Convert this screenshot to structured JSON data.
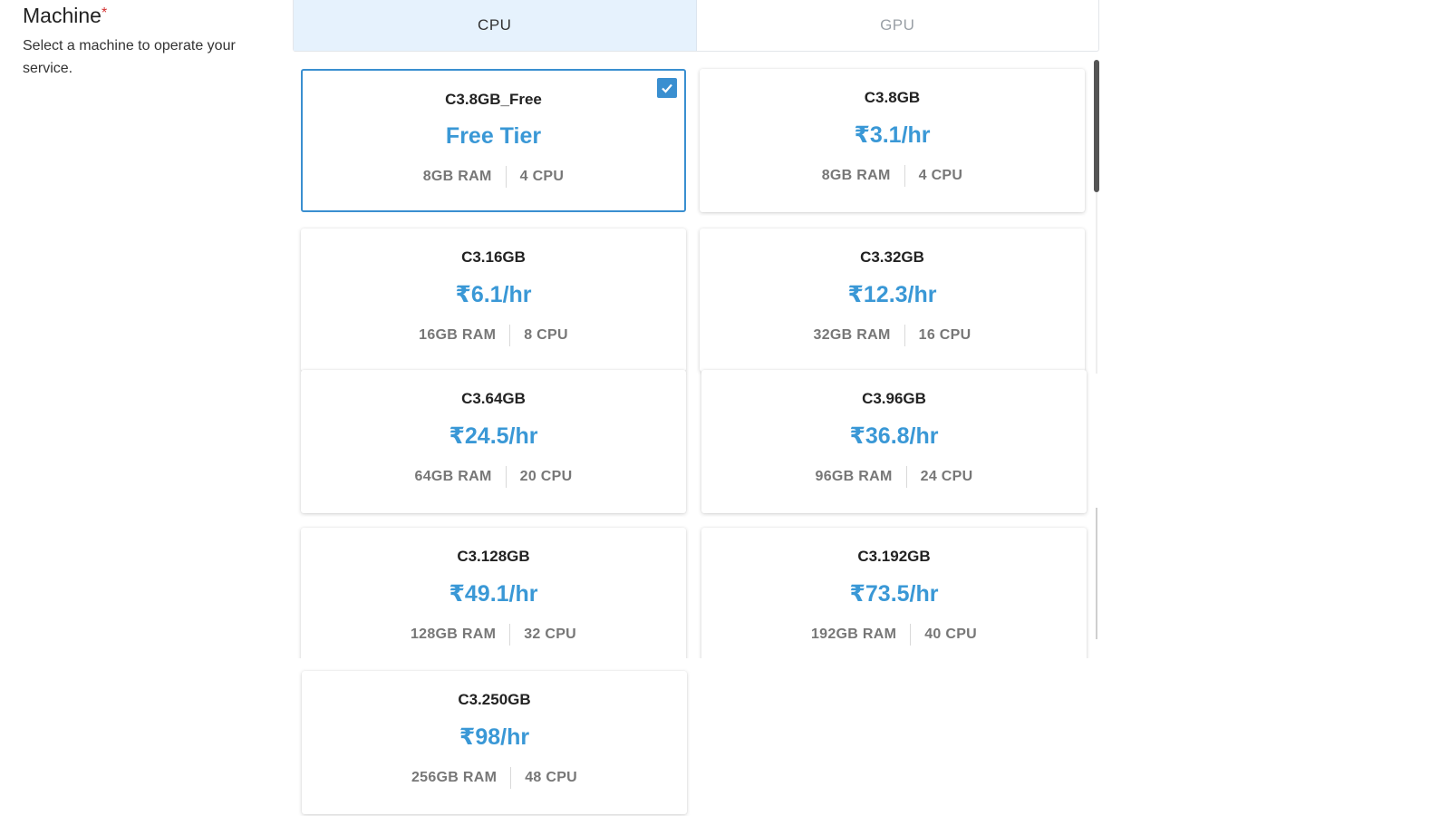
{
  "section": {
    "title": "Machine",
    "required_mark": "*",
    "description": "Select a machine to operate your service."
  },
  "tabs": [
    {
      "label": "CPU",
      "active": true
    },
    {
      "label": "GPU",
      "active": false
    }
  ],
  "machines": [
    {
      "name": "C3.8GB_Free",
      "price": "Free Tier",
      "ram": "8GB RAM",
      "cpu": "4 CPU",
      "selected": true
    },
    {
      "name": "C3.8GB",
      "price": "₹3.1/hr",
      "ram": "8GB RAM",
      "cpu": "4 CPU",
      "selected": false
    },
    {
      "name": "C3.16GB",
      "price": "₹6.1/hr",
      "ram": "16GB RAM",
      "cpu": "8 CPU",
      "selected": false
    },
    {
      "name": "C3.32GB",
      "price": "₹12.3/hr",
      "ram": "32GB RAM",
      "cpu": "16 CPU",
      "selected": false
    },
    {
      "name": "C3.64GB",
      "price": "₹24.5/hr",
      "ram": "64GB RAM",
      "cpu": "20 CPU",
      "selected": false
    },
    {
      "name": "C3.96GB",
      "price": "₹36.8/hr",
      "ram": "96GB RAM",
      "cpu": "24 CPU",
      "selected": false
    },
    {
      "name": "C3.128GB",
      "price": "₹49.1/hr",
      "ram": "128GB RAM",
      "cpu": "32 CPU",
      "selected": false
    },
    {
      "name": "C3.192GB",
      "price": "₹73.5/hr",
      "ram": "192GB RAM",
      "cpu": "40 CPU",
      "selected": false
    },
    {
      "name": "C3.250GB",
      "price": "₹98/hr",
      "ram": "256GB RAM",
      "cpu": "48 CPU",
      "selected": false
    }
  ],
  "colors": {
    "accent": "#3a98d6",
    "selected_border": "#3a8fd0",
    "active_tab_bg": "#e6f2fd",
    "required": "#d32f2f"
  },
  "icons": {
    "selected_check": "check-icon"
  }
}
